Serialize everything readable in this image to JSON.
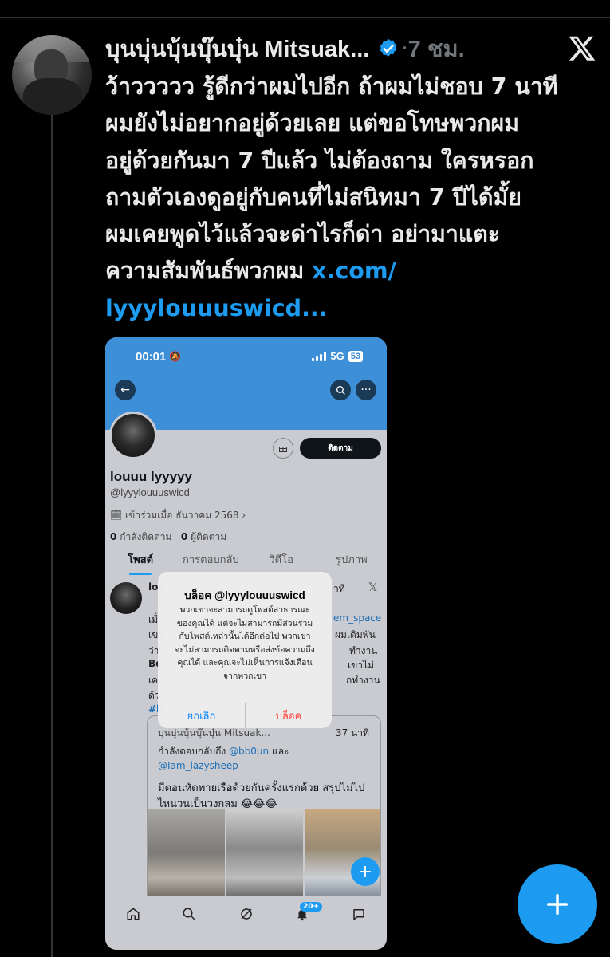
{
  "tweet": {
    "author_name": "บุนบุ่นบุ้นบุ๊นบุ๋น Mitsuak...",
    "dot": "·",
    "time": "7 ชม.",
    "lines": [
      "ว้าววววว รู้ดีกว่าผมไปอีก ถ้าผมไม่ชอบ 7 นาที",
      "ผมยังไม่อยากอยู่ด้วยเลย แต่ขอโทษพวกผม",
      "อยู่ด้วยกันมา 7 ปีแล้ว ไม่ต้องถาม ใครหรอก",
      "ถามตัวเองดูอยู่กับคนที่ไม่สนิทมา 7 ปีได้มั้ย",
      "ผมเคยพูดไว้แล้วจะด่าไรก็ด่า อย่ามาแตะ"
    ],
    "line6_text": "ความสัมพันธ์พวกผม ",
    "link_part1": "x.com/",
    "link_part2": "lyyylouuuswicd..."
  },
  "screenshot": {
    "status_time": "00:01",
    "network": "5G",
    "battery": "53",
    "follow_label": "ติดตาม",
    "profile_name": "louuu lyyyyy",
    "profile_handle": "@lyyylouuuswicd",
    "joined": "เข้าร่วมเมื่อ ธันวาคม 2568",
    "following_count": "0",
    "following_label": "กำลังติดตาม",
    "followers_count": "0",
    "followers_label": "ผู้ติดตาม",
    "tabs": [
      "โพสต์",
      "การตอบกลับ",
      "วิดีโอ",
      "รูปภาพ"
    ],
    "post_fragments": {
      "name": "lou",
      "time": "าที",
      "f1": "เมื่",
      "f2": "em_space",
      "f3": "เขา",
      "f4": "ผมเดิมพัน",
      "f5": "ว่า",
      "f6": "ทำงาน",
      "f7": "Bo",
      "f8": "เขาไม่",
      "f9": "เค",
      "f10": "กทำงาน",
      "f11": "ด้ว",
      "f12": "#b"
    },
    "quote": {
      "author": "บุนบุ่นบุ้นบุ๊นบุ๋น Mitsuak...",
      "time": "37 นาที",
      "reply_prefix": "กำลังตอบกลับถึง",
      "reply_user1": "@bb0un",
      "reply_and": "และ",
      "reply_user2": "@Iam_lazysheep",
      "text_line1": "มีตอนหัดพายเรือด้วยกันครั้งแรกด้วย สรุปไม่ไป",
      "text_line2": "ไหนวนเป็นวงกลม 😂😂😂"
    },
    "nav_badge": "20+",
    "dialog": {
      "title": "บล็อค @lyyylouuuswicd",
      "body_lines": [
        "พวกเขาจะสามารถดูโพสต์สาธารณะ",
        "ของคุณได้ แต่จะไม่สามารถมีส่วนร่วม",
        "กับโพสต์เหล่านั้นได้อีกต่อไป พวกเขา",
        "จะไม่สามารถติดตามหรือส่งข้อความถึง",
        "คุณได้ และคุณจะไม่เห็นการแจ้งเตือน",
        "จากพวกเขา"
      ],
      "cancel": "ยกเลิก",
      "block": "บล็อค"
    }
  },
  "colors": {
    "background": "#000000",
    "accent": "#1d9bf0",
    "text": "#e7e9ea",
    "muted": "#71767b",
    "destructive": "#ff3b30"
  },
  "icons": [
    "x-logo-icon",
    "verified-badge-icon",
    "plus-icon",
    "back-arrow-icon",
    "search-icon",
    "more-icon",
    "home-icon",
    "grok-icon",
    "bell-icon",
    "mail-icon",
    "calendar-icon",
    "gift-icon"
  ]
}
